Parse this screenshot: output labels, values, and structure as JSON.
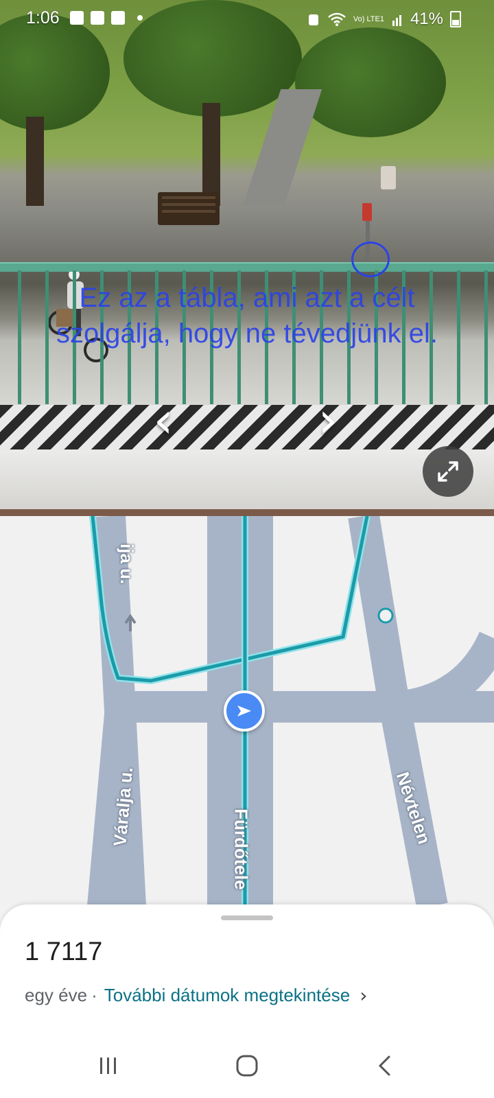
{
  "status_bar": {
    "time": "1:06",
    "network": "Vo) LTE1",
    "battery": "41%"
  },
  "street_view": {
    "annotation_text": "Ez az a tábla, ami azt a célt szolgálja, hogy ne tévedjünk el.",
    "prev_label": "‹",
    "next_label": "›"
  },
  "map": {
    "roads": {
      "top_left": "ija u.",
      "left": "Váralja u.",
      "center": "Fürdőtele",
      "right": "Névtelen"
    },
    "colors": {
      "road": "#a7b4c8",
      "route": "#1c9aa8",
      "route_outline": "#8fe3ea",
      "marker": "#4a8af4"
    }
  },
  "sheet": {
    "title": "1 7117",
    "date": "egy éve",
    "separator": "·",
    "more_dates_link": "További dátumok megtekintése"
  },
  "icons": {
    "expand": "expand-icon",
    "chevron": "chevron-right-icon",
    "recents": "recents-icon",
    "home": "home-icon",
    "back": "back-icon"
  }
}
